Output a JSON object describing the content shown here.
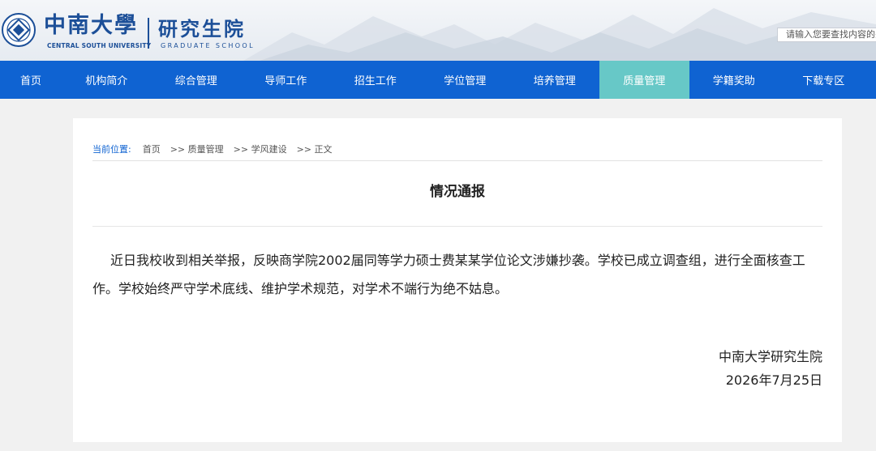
{
  "header": {
    "university_cn": "中南大學",
    "university_en": "CENTRAL SOUTH UNIVERSITY",
    "school_cn": "研究生院",
    "school_en": "GRADUATE SCHOOL",
    "search_placeholder": "请输入您要查找内容的关"
  },
  "nav": {
    "items": [
      {
        "label": "首页"
      },
      {
        "label": "机构简介"
      },
      {
        "label": "综合管理"
      },
      {
        "label": "导师工作"
      },
      {
        "label": "招生工作"
      },
      {
        "label": "学位管理"
      },
      {
        "label": "培养管理"
      },
      {
        "label": "质量管理"
      },
      {
        "label": "学籍奖助"
      },
      {
        "label": "下载专区"
      }
    ],
    "active_index": 7,
    "bar_color": "#0f63d2",
    "active_color": "#67c8c7"
  },
  "breadcrumb": {
    "label": "当前位置:",
    "parts": [
      "首页",
      ">> 质量管理",
      ">> 学风建设",
      ">> 正文"
    ]
  },
  "article": {
    "title": "情况通报",
    "body": "近日我校收到相关举报，反映商学院2002届同等学力硕士费某某学位论文涉嫌抄袭。学校已成立调查组，进行全面核查工作。学校始终严守学术底线、维护学术规范，对学术不端行为绝不姑息。",
    "signature": "中南大学研究生院",
    "date": "2026年7月25日"
  }
}
